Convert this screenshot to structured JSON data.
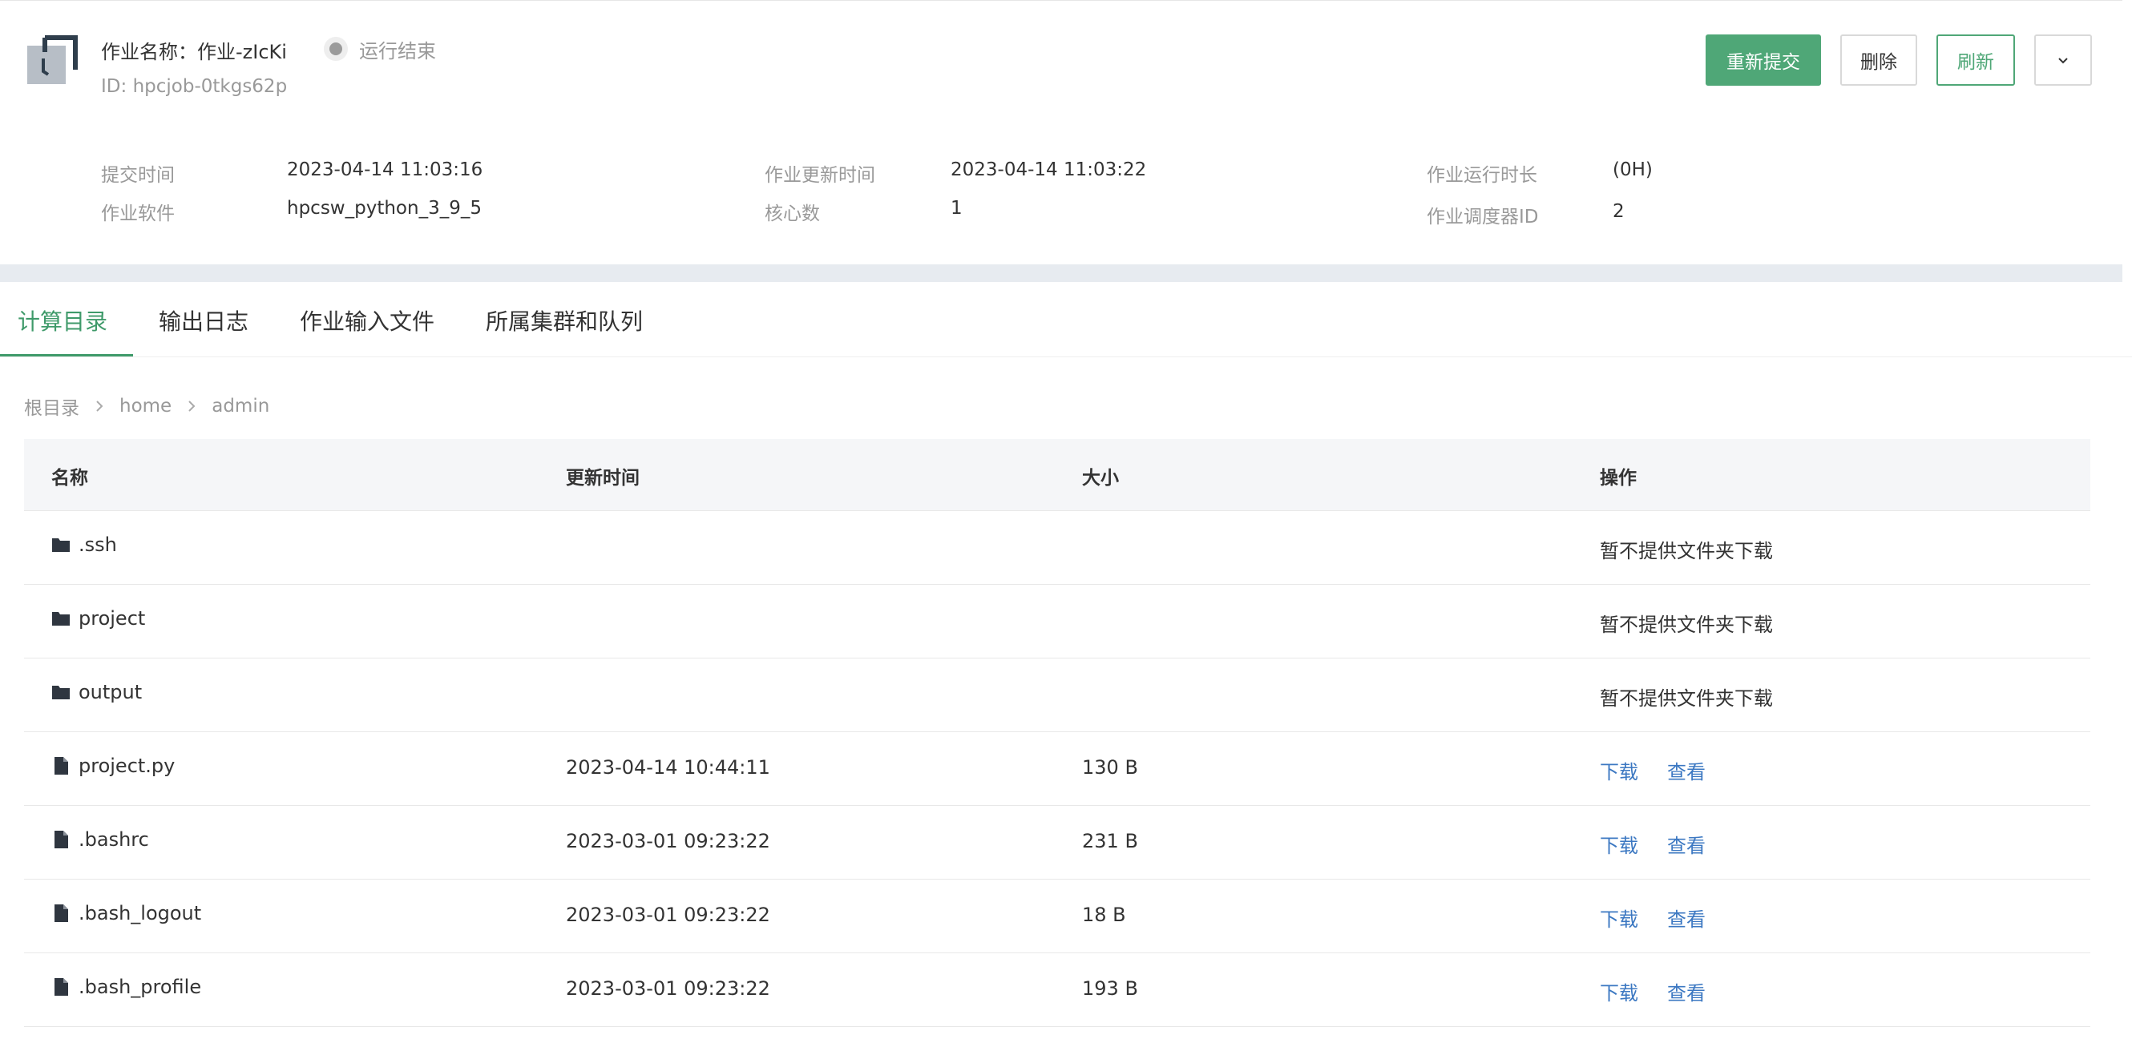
{
  "header": {
    "job_name_label": "作业名称：",
    "job_name": "作业-zIcKi",
    "status": "运行结束",
    "job_id_label": "ID: ",
    "job_id": "hpcjob-0tkgs62p",
    "actions": {
      "resubmit": "重新提交",
      "delete": "删除",
      "refresh": "刷新"
    }
  },
  "meta": {
    "submit_time_label": "提交时间",
    "submit_time": "2023-04-14 11:03:16",
    "software_label": "作业软件",
    "software": "hpcsw_python_3_9_5",
    "update_time_label": "作业更新时间",
    "update_time": "2023-04-14 11:03:22",
    "cores_label": "核心数",
    "cores": "1",
    "duration_label": "作业运行时长",
    "duration": "(0H)",
    "scheduler_id_label": "作业调度器ID",
    "scheduler_id": "2"
  },
  "tabs": [
    {
      "label": "计算目录",
      "active": true
    },
    {
      "label": "输出日志",
      "active": false
    },
    {
      "label": "作业输入文件",
      "active": false
    },
    {
      "label": "所属集群和队列",
      "active": false
    }
  ],
  "breadcrumb": [
    "根目录",
    "home",
    "admin"
  ],
  "table": {
    "columns": [
      "名称",
      "更新时间",
      "大小",
      "操作"
    ],
    "rows": [
      {
        "type": "folder",
        "name": ".ssh",
        "time": "",
        "size": "",
        "op_note": "暂不提供文件夹下载"
      },
      {
        "type": "folder",
        "name": "project",
        "time": "",
        "size": "",
        "op_note": "暂不提供文件夹下载"
      },
      {
        "type": "folder",
        "name": "output",
        "time": "",
        "size": "",
        "op_note": "暂不提供文件夹下载"
      },
      {
        "type": "file",
        "name": "project.py",
        "time": "2023-04-14 10:44:11",
        "size": "130 B",
        "download": "下载",
        "view": "查看"
      },
      {
        "type": "file",
        "name": ".bashrc",
        "time": "2023-03-01 09:23:22",
        "size": "231 B",
        "download": "下载",
        "view": "查看"
      },
      {
        "type": "file",
        "name": ".bash_logout",
        "time": "2023-03-01 09:23:22",
        "size": "18 B",
        "download": "下载",
        "view": "查看"
      },
      {
        "type": "file",
        "name": ".bash_profile",
        "time": "2023-03-01 09:23:22",
        "size": "193 B",
        "download": "下载",
        "view": "查看"
      }
    ]
  },
  "colors": {
    "primary": "#4fa777",
    "tab_active": "#3f9a6a",
    "link": "#3c78c2",
    "muted": "#999999"
  }
}
